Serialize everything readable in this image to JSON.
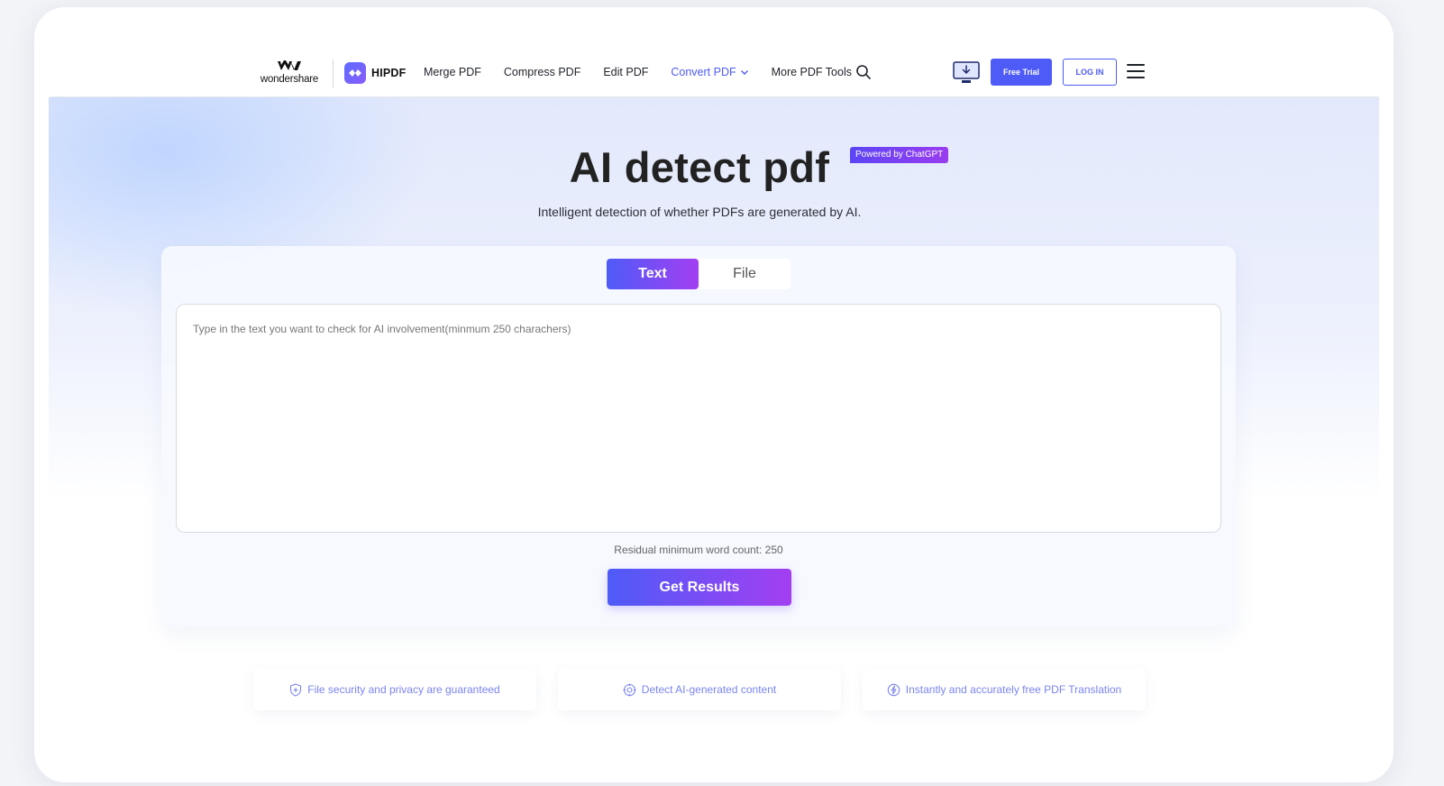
{
  "nav": {
    "brand_text": "wondershare",
    "product_name": "HIPDF",
    "menu": [
      {
        "label": "Merge PDF",
        "active": false
      },
      {
        "label": "Compress PDF",
        "active": false
      },
      {
        "label": "Edit PDF",
        "active": false
      },
      {
        "label": "Convert PDF",
        "active": true
      },
      {
        "label": "More PDF Tools",
        "active": false
      }
    ],
    "free_trial_label": "Free Trial",
    "login_label": "LOG IN"
  },
  "hero": {
    "title": "AI detect pdf",
    "badge": "Powered by ChatGPT",
    "subtitle": "Intelligent detection of whether PDFs are generated by AI."
  },
  "tool": {
    "tabs": [
      {
        "label": "Text",
        "active": true
      },
      {
        "label": "File",
        "active": false
      }
    ],
    "input": {
      "value": "",
      "placeholder": "Type in the text you want to check for AI involvement(minmum 250 charachers)"
    },
    "word_count": "Residual minimum word count: 250",
    "submit_label": "Get Results"
  },
  "features": [
    {
      "icon": "shield-plus-icon",
      "label": "File security and privacy are guaranteed"
    },
    {
      "icon": "target-icon",
      "label": "Detect AI-generated content"
    },
    {
      "icon": "lightning-icon",
      "label": "Instantly and accurately free PDF Translation"
    }
  ],
  "colors": {
    "accent": "#4e5bf7",
    "gradient_end": "#a33ff2",
    "feature_text": "#7a85f0"
  }
}
